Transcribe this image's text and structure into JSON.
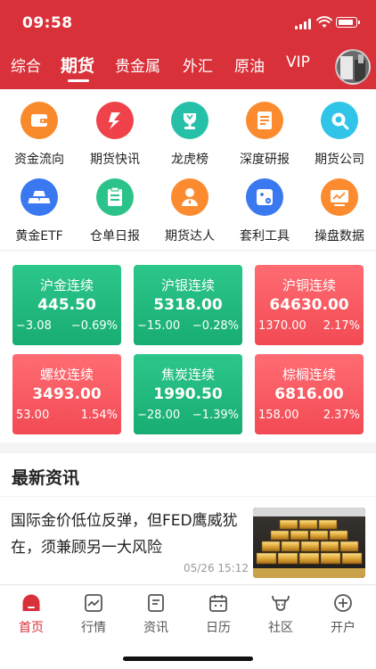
{
  "status": {
    "time": "09:58"
  },
  "tabs": [
    {
      "label": "综合",
      "active": false
    },
    {
      "label": "期货",
      "active": true
    },
    {
      "label": "贵金属",
      "active": false
    },
    {
      "label": "外汇",
      "active": false
    },
    {
      "label": "原油",
      "active": false
    },
    {
      "label": "VIP",
      "active": false
    }
  ],
  "grid": [
    {
      "label": "资金流向",
      "icon": "wallet-icon",
      "color": "#f98a2c"
    },
    {
      "label": "期货快讯",
      "icon": "flash-icon",
      "color": "#f0424a"
    },
    {
      "label": "龙虎榜",
      "icon": "trophy-icon",
      "color": "#26c0a8"
    },
    {
      "label": "深度研报",
      "icon": "report-icon",
      "color": "#fb8b2e"
    },
    {
      "label": "期货公司",
      "icon": "search-company-icon",
      "color": "#2fc4e8"
    },
    {
      "label": "黄金ETF",
      "icon": "gold-bars-icon",
      "color": "#3a78f0"
    },
    {
      "label": "仓单日报",
      "icon": "clipboard-icon",
      "color": "#2cc38a"
    },
    {
      "label": "期货达人",
      "icon": "expert-icon",
      "color": "#fb8b2e"
    },
    {
      "label": "套利工具",
      "icon": "arbitrage-tool-icon",
      "color": "#3a78f0"
    },
    {
      "label": "操盘数据",
      "icon": "trade-chart-icon",
      "color": "#fb8b2e"
    }
  ],
  "cards": [
    {
      "name": "沪金连续",
      "price": "445.50",
      "change": "−3.08",
      "pct": "−0.69%",
      "trend": "down"
    },
    {
      "name": "沪银连续",
      "price": "5318.00",
      "change": "−15.00",
      "pct": "−0.28%",
      "trend": "down"
    },
    {
      "name": "沪铜连续",
      "price": "64630.00",
      "change": "1370.00",
      "pct": "2.17%",
      "trend": "up"
    },
    {
      "name": "螺纹连续",
      "price": "3493.00",
      "change": "53.00",
      "pct": "1.54%",
      "trend": "up"
    },
    {
      "name": "焦炭连续",
      "price": "1990.50",
      "change": "−28.00",
      "pct": "−1.39%",
      "trend": "down"
    },
    {
      "name": "棕榈连续",
      "price": "6816.00",
      "change": "158.00",
      "pct": "2.37%",
      "trend": "up"
    }
  ],
  "news": {
    "header": "最新资讯",
    "items": [
      {
        "title": "国际金价低位反弹，但FED鹰威犹在，须兼顾另一大风险",
        "time": "05/26 15:12"
      }
    ]
  },
  "bottom_nav": [
    {
      "label": "首页",
      "icon": "home-icon",
      "active": true
    },
    {
      "label": "行情",
      "icon": "market-chart-icon",
      "active": false
    },
    {
      "label": "资讯",
      "icon": "news-icon",
      "active": false
    },
    {
      "label": "日历",
      "icon": "calendar-icon",
      "active": false
    },
    {
      "label": "社区",
      "icon": "community-icon",
      "active": false
    },
    {
      "label": "开户",
      "icon": "open-account-icon",
      "active": false
    }
  ],
  "colors": {
    "brand_red": "#d9313a",
    "up": "#f24a54",
    "down": "#18ad72"
  }
}
